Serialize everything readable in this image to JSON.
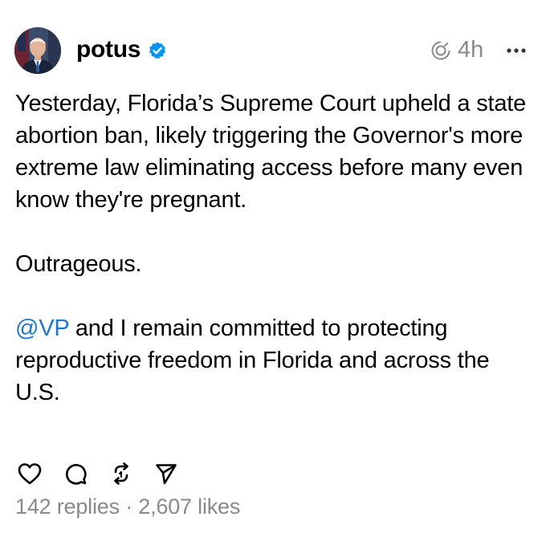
{
  "post": {
    "username": "potus",
    "time_ago": "4h",
    "avatar": "profile-photo",
    "text": {
      "paragraph1": "Yesterday, Florida’s Supreme Court upheld a state abortion ban, likely triggering the Governor's more extreme law eliminating access before many even know they're pregnant.",
      "paragraph2": "Outrageous.",
      "mention": "@VP",
      "paragraph3_rest": " and I remain committed to protecting reproductive freedom in Florida and across the U.S."
    },
    "icons": {
      "verified": "verified-badge-icon",
      "thread": "threads-icon",
      "more": "more-options-icon",
      "like": "heart-icon",
      "reply": "comment-icon",
      "repost": "repost-icon",
      "share": "send-icon"
    },
    "colors": {
      "mention": "#1d76d6",
      "verified": "#0095f6",
      "muted": "#8a8a8a"
    },
    "stats": {
      "replies": "142 replies",
      "separator": " · ",
      "likes": "2,607 likes"
    }
  }
}
